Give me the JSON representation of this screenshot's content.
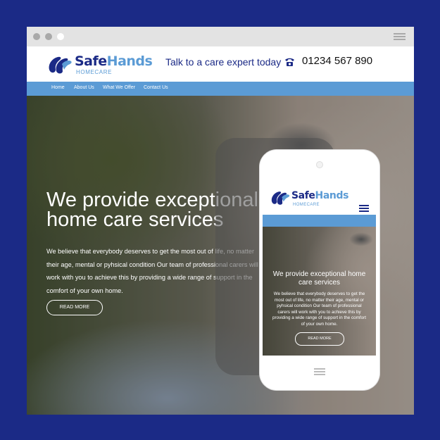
{
  "colors": {
    "background": "#1b2a86",
    "brand_navy": "#1b2a86",
    "brand_blue": "#5b9bd5",
    "nav_bar": "#5b9bd5"
  },
  "window": {
    "controls": [
      "close-dot",
      "minimize-dot",
      "maximize-dot"
    ],
    "menu_icon": "hamburger-icon"
  },
  "brand": {
    "name": "SafeHands",
    "name_safe": "Safe",
    "name_hands": "Hands",
    "tagline": "HOMECARE",
    "logo_icon": "hands-logo-icon"
  },
  "header": {
    "cta": "Talk to a care expert today",
    "phone_icon": "telephone-icon",
    "phone": "01234 567 890"
  },
  "nav": {
    "items": [
      {
        "label": "Home"
      },
      {
        "label": "About Us"
      },
      {
        "label": "What We Offer"
      },
      {
        "label": "Contact Us"
      }
    ]
  },
  "hero": {
    "title_line1": "We provide exceptional",
    "title_line2": "home care services",
    "body_line1": "We believe that everybody deserves to get the most out of life, no matter",
    "body_line2": "their age, mental or pyhsical condition Our team of professional carers will",
    "body_line3": "work with you to achieve this by providing a wide range of support in the",
    "body_line4": "comfort of your own home.",
    "button": "READ MORE"
  },
  "mobile": {
    "menu_icon": "hamburger-icon",
    "title": "We provide exceptional home care services",
    "body": "We believe that everybody deserves to get the most out of life, no matter their age, mental or pyhsical condition Our team of professional carers will work with you to achieve this by providing a wide range of support in the comfort of your own home.",
    "button": "READ MORE"
  }
}
